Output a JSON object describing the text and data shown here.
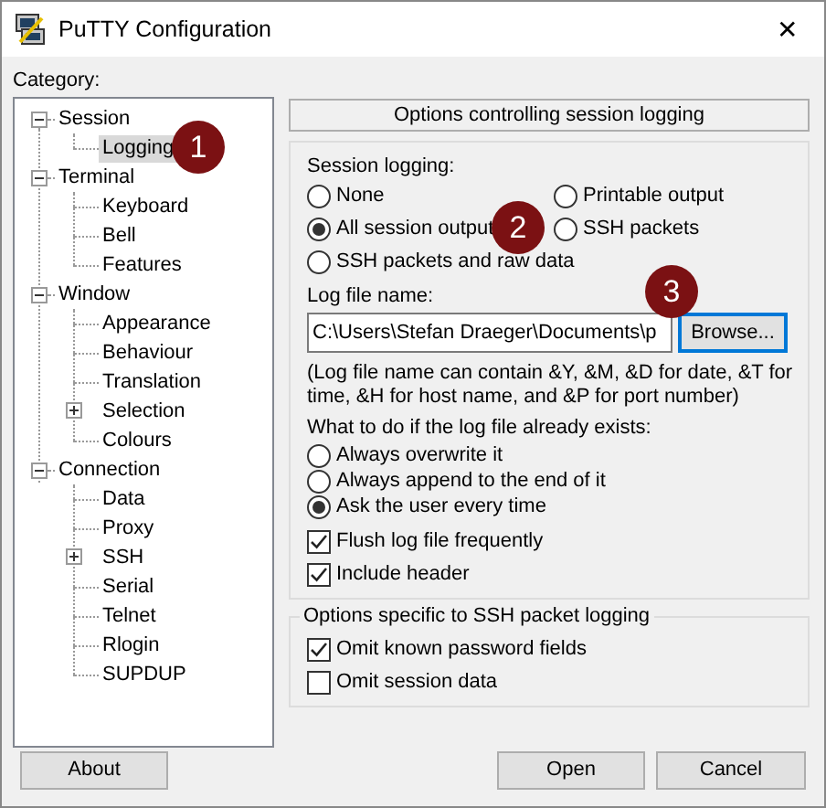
{
  "window": {
    "title": "PuTTY Configuration",
    "close": "✕"
  },
  "category_label": "Category:",
  "tree": [
    {
      "label": "Session",
      "expanded": true,
      "selected": false,
      "children": [
        {
          "label": "Logging",
          "selected": true
        }
      ]
    },
    {
      "label": "Terminal",
      "expanded": true,
      "selected": false,
      "children": [
        {
          "label": "Keyboard",
          "selected": false
        },
        {
          "label": "Bell",
          "selected": false
        },
        {
          "label": "Features",
          "selected": false
        }
      ]
    },
    {
      "label": "Window",
      "expanded": true,
      "selected": false,
      "children": [
        {
          "label": "Appearance",
          "selected": false
        },
        {
          "label": "Behaviour",
          "selected": false
        },
        {
          "label": "Translation",
          "selected": false
        },
        {
          "label": "Selection",
          "expanded": false,
          "selected": false
        },
        {
          "label": "Colours",
          "selected": false
        }
      ]
    },
    {
      "label": "Connection",
      "expanded": true,
      "selected": false,
      "children": [
        {
          "label": "Data",
          "selected": false
        },
        {
          "label": "Proxy",
          "selected": false
        },
        {
          "label": "SSH",
          "expanded": false,
          "selected": false
        },
        {
          "label": "Serial",
          "selected": false
        },
        {
          "label": "Telnet",
          "selected": false
        },
        {
          "label": "Rlogin",
          "selected": false
        },
        {
          "label": "SUPDUP",
          "selected": false
        }
      ]
    }
  ],
  "panel_header": "Options controlling session logging",
  "session_logging": {
    "label": "Session logging:",
    "options": [
      {
        "label": "None",
        "selected": false
      },
      {
        "label": "Printable output",
        "selected": false
      },
      {
        "label": "All session output",
        "selected": true
      },
      {
        "label": "SSH packets",
        "selected": false
      },
      {
        "label": "SSH packets and raw data",
        "selected": false
      }
    ]
  },
  "log_file": {
    "label": "Log file name:",
    "value": "C:\\Users\\Stefan Draeger\\Documents\\p",
    "browse": "Browse..."
  },
  "hint": "(Log file name can contain &Y, &M, &D for date, &T for time, &H for host name, and &P for port number)",
  "exists": {
    "label": "What to do if the log file already exists:",
    "options": [
      {
        "label": "Always overwrite it",
        "selected": false
      },
      {
        "label": "Always append to the end of it",
        "selected": false
      },
      {
        "label": "Ask the user every time",
        "selected": true
      }
    ]
  },
  "flags": [
    {
      "label": "Flush log file frequently",
      "checked": true
    },
    {
      "label": "Include header",
      "checked": true
    }
  ],
  "ssh_group": {
    "title": "Options specific to SSH packet logging",
    "options": [
      {
        "label": "Omit known password fields",
        "checked": true
      },
      {
        "label": "Omit session data",
        "checked": false
      }
    ]
  },
  "buttons": {
    "about": "About",
    "open": "Open",
    "cancel": "Cancel"
  },
  "annotations": [
    "1",
    "2",
    "3"
  ]
}
